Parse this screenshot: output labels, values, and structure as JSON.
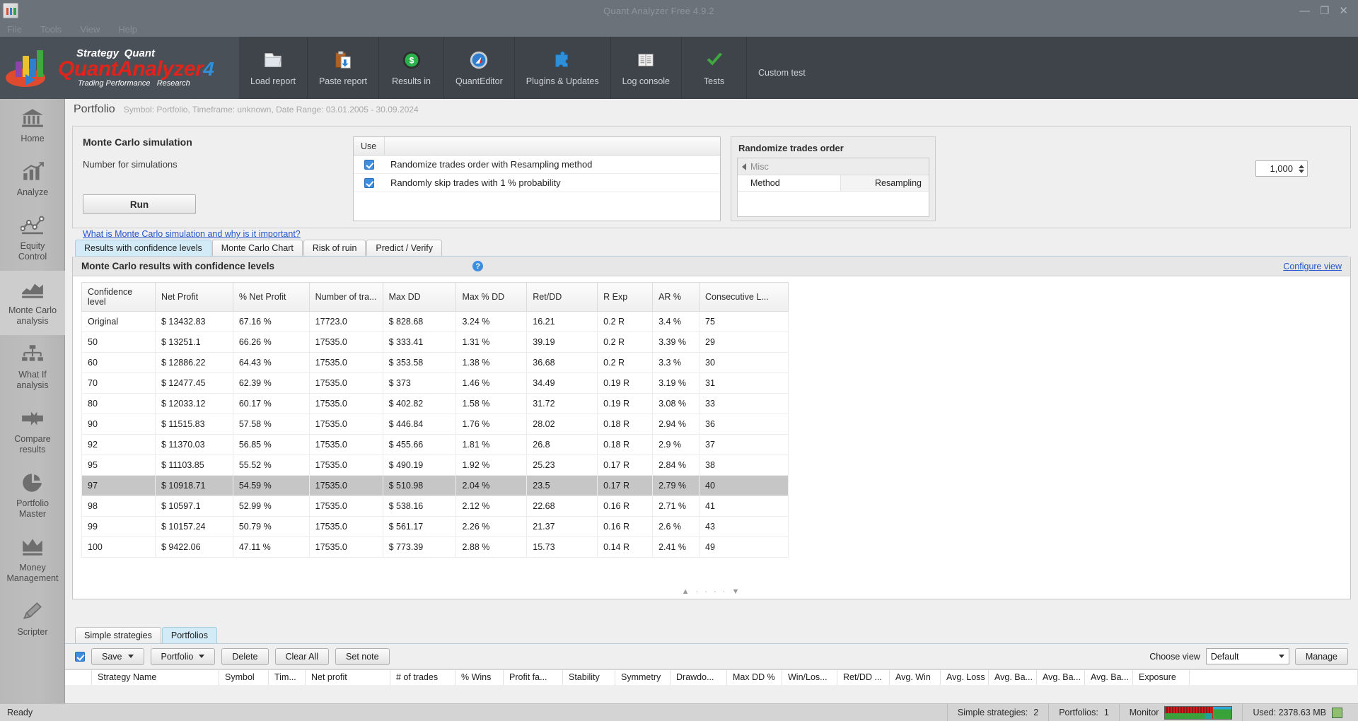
{
  "window": {
    "title": "Quant Analyzer Free 4.9.2",
    "minimize": "—",
    "maximize": "❐",
    "close": "✕",
    "app_icon": "quant-analyzer-icon"
  },
  "menubar": {
    "items": [
      "File",
      "Tools",
      "View",
      "Help"
    ]
  },
  "brand": {
    "strategy": "Strategy",
    "quant": "Quant",
    "main_1": "Quant",
    "main_2": "Analyzer",
    "version": "4",
    "sub_1": "Trading Performance",
    "sub_2": "Research"
  },
  "ribbon": {
    "items": [
      {
        "label": "Load report",
        "icon": "folder-icon"
      },
      {
        "label": "Paste report",
        "icon": "clipboard-paste-icon"
      },
      {
        "label": "Results in",
        "icon": "dollar-coin-icon"
      },
      {
        "label": "QuantEditor",
        "icon": "compass-icon"
      },
      {
        "label": "Plugins & Updates",
        "icon": "puzzle-piece-icon"
      },
      {
        "label": "Log console",
        "icon": "book-icon"
      },
      {
        "label": "Tests",
        "icon": "check-mark-icon"
      },
      {
        "label": "Custom test",
        "icon": ""
      }
    ]
  },
  "sidebar": {
    "items": [
      {
        "label": "Home",
        "icon": "bank-icon",
        "active": false
      },
      {
        "label": "Analyze",
        "icon": "bar-chart-arrow-icon",
        "active": false
      },
      {
        "label": "Equity\nControl",
        "line1": "Equity",
        "line2": "Control",
        "icon": "line-chart-nodes-icon",
        "active": false
      },
      {
        "label": "Monte Carlo analysis",
        "line1": "Monte Carlo",
        "line2": "analysis",
        "icon": "area-chart-icon",
        "active": true
      },
      {
        "label": "What If analysis",
        "line1": "What If",
        "line2": "analysis",
        "icon": "hierarchy-icon",
        "active": false
      },
      {
        "label": "Compare results",
        "line1": "Compare",
        "line2": "results",
        "icon": "arrows-converge-icon",
        "active": false
      },
      {
        "label": "Portfolio Master",
        "line1": "Portfolio",
        "line2": "Master",
        "icon": "pie-chart-icon",
        "active": false
      },
      {
        "label": "Money Management",
        "line1": "Money",
        "line2": "Management",
        "icon": "crown-icon",
        "active": false
      },
      {
        "label": "Scripter",
        "line1": "Scripter",
        "line2": "",
        "icon": "pencil-icon",
        "active": false
      }
    ]
  },
  "page": {
    "title": "Portfolio",
    "subtitle": "Symbol: Portfolio, Timeframe: unknown, Date Range: 03.01.2005 - 30.09.2024"
  },
  "monte_carlo": {
    "heading": "Monte Carlo simulation",
    "number_label": "Number for simulations",
    "number_value": "1,000",
    "run_label": "Run",
    "help_link": "What is Monte Carlo simulation and why is it important?",
    "use_header": "Use",
    "options": [
      {
        "label": "Randomize trades order with Resampling method",
        "checked": true
      },
      {
        "label": "Randomly skip trades with 1 % probability",
        "checked": true
      }
    ]
  },
  "randomize_panel": {
    "title": "Randomize trades order",
    "group": "Misc",
    "rows": [
      {
        "key": "Method",
        "value": "Resampling"
      }
    ]
  },
  "tabs": [
    {
      "label": "Results with confidence levels",
      "active": true
    },
    {
      "label": "Monte Carlo Chart",
      "active": false
    },
    {
      "label": "Risk of ruin",
      "active": false
    },
    {
      "label": "Predict / Verify",
      "active": false
    }
  ],
  "results": {
    "title": "Monte Carlo results with confidence levels",
    "help_icon": "?",
    "configure_view": "Configure view",
    "scroll_hint": "▲ · · · · ▼"
  },
  "chart_data": {
    "type": "table",
    "title": "Monte Carlo results with confidence levels",
    "columns": [
      "Confidence level",
      "Net Profit",
      "% Net Profit",
      "Number of tra...",
      "Max DD",
      "Max % DD",
      "Ret/DD",
      "R Exp",
      "AR %",
      "Consecutive L..."
    ],
    "selected_row_index": 8,
    "rows": [
      [
        "Original",
        "$ 13432.83",
        "67.16 %",
        "17723.0",
        "$ 828.68",
        "3.24 %",
        "16.21",
        "0.2 R",
        "3.4 %",
        "75"
      ],
      [
        "50",
        "$ 13251.1",
        "66.26 %",
        "17535.0",
        "$ 333.41",
        "1.31 %",
        "39.19",
        "0.2 R",
        "3.39 %",
        "29"
      ],
      [
        "60",
        "$ 12886.22",
        "64.43 %",
        "17535.0",
        "$ 353.58",
        "1.38 %",
        "36.68",
        "0.2 R",
        "3.3 %",
        "30"
      ],
      [
        "70",
        "$ 12477.45",
        "62.39 %",
        "17535.0",
        "$ 373",
        "1.46 %",
        "34.49",
        "0.19 R",
        "3.19 %",
        "31"
      ],
      [
        "80",
        "$ 12033.12",
        "60.17 %",
        "17535.0",
        "$ 402.82",
        "1.58 %",
        "31.72",
        "0.19 R",
        "3.08 %",
        "33"
      ],
      [
        "90",
        "$ 11515.83",
        "57.58 %",
        "17535.0",
        "$ 446.84",
        "1.76 %",
        "28.02",
        "0.18 R",
        "2.94 %",
        "36"
      ],
      [
        "92",
        "$ 11370.03",
        "56.85 %",
        "17535.0",
        "$ 455.66",
        "1.81 %",
        "26.8",
        "0.18 R",
        "2.9 %",
        "37"
      ],
      [
        "95",
        "$ 11103.85",
        "55.52 %",
        "17535.0",
        "$ 490.19",
        "1.92 %",
        "25.23",
        "0.17 R",
        "2.84 %",
        "38"
      ],
      [
        "97",
        "$ 10918.71",
        "54.59 %",
        "17535.0",
        "$ 510.98",
        "2.04 %",
        "23.5",
        "0.17 R",
        "2.79 %",
        "40"
      ],
      [
        "98",
        "$ 10597.1",
        "52.99 %",
        "17535.0",
        "$ 538.16",
        "2.12 %",
        "22.68",
        "0.16 R",
        "2.71 %",
        "41"
      ],
      [
        "99",
        "$ 10157.24",
        "50.79 %",
        "17535.0",
        "$ 561.17",
        "2.26 %",
        "21.37",
        "0.16 R",
        "2.6 %",
        "43"
      ],
      [
        "100",
        "$ 9422.06",
        "47.11 %",
        "17535.0",
        "$ 773.39",
        "2.88 %",
        "15.73",
        "0.14 R",
        "2.41 %",
        "49"
      ]
    ]
  },
  "bottom": {
    "tabs": [
      {
        "label": "Simple strategies",
        "active": false
      },
      {
        "label": "Portfolios",
        "active": true
      }
    ],
    "select_all_checked": true,
    "buttons": [
      {
        "label": "Save",
        "has_caret": true
      },
      {
        "label": "Portfolio",
        "has_caret": true
      },
      {
        "label": "Delete",
        "has_caret": false
      },
      {
        "label": "Clear All",
        "has_caret": false
      },
      {
        "label": "Set note",
        "has_caret": false
      }
    ],
    "choose_view_label": "Choose view",
    "choose_view_value": "Default",
    "manage_label": "Manage",
    "grid_columns": [
      "Strategy Name",
      "Symbol",
      "Tim...",
      "Net profit",
      "# of trades",
      "% Wins",
      "Profit fa...",
      "Stability",
      "Symmetry",
      "Drawdo...",
      "Max DD %",
      "Win/Los...",
      "Ret/DD ...",
      "Avg. Win",
      "Avg. Loss",
      "Avg. Ba...",
      "Avg. Ba...",
      "Avg. Ba...",
      "Exposure"
    ]
  },
  "statusbar": {
    "ready": "Ready",
    "simple_strategies_label": "Simple strategies:",
    "simple_strategies_value": "2",
    "portfolios_label": "Portfolios:",
    "portfolios_value": "1",
    "monitor_label": "Monitor",
    "memory": "Used: 2378.63 MB",
    "trash_icon": "recycle-icon"
  },
  "colors": {
    "accent_red": "#e2231a",
    "accent_blue": "#2f8fd8",
    "link": "#2255cc",
    "ribbon_bg": "#3f444b",
    "titlebar_bg": "#6c7279",
    "selection": "#c6c6c6",
    "tab_active": "#d3eaf7"
  }
}
